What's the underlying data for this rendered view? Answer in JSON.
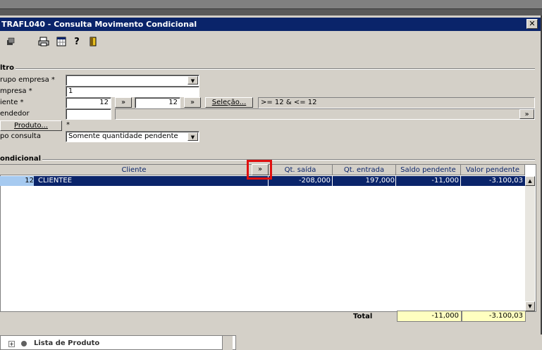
{
  "window": {
    "title": "TRAFL040 - Consulta Movimento Condicional",
    "close_label": "✕"
  },
  "toolbar": {
    "icons": [
      "window-icon",
      "printer-icon",
      "calculator-icon",
      "help-icon",
      "exit-icon"
    ],
    "help_glyph": "?"
  },
  "filter": {
    "legend": "ltro",
    "grupo_empresa_label": "rupo empresa *",
    "grupo_empresa_value": "",
    "empresa_label": "mpresa *",
    "empresa_value": "1",
    "cliente_label": "iente *",
    "cliente_from": "12",
    "cliente_to": "12",
    "more_label": "»",
    "selecao_label": "Seleção...",
    "selecao_expr": ">= 12 & <= 12",
    "vendedor_label": "endedor",
    "vendedor_value": "",
    "produto_label": "Produto...",
    "produto_value": "*",
    "tipo_label": "po consulta",
    "tipo_value": "Somente quantidade pendente"
  },
  "grid": {
    "legend": "ondicional",
    "columns": [
      "Cliente",
      "Qt. saída",
      "Qt. entrada",
      "Saldo pendente",
      "Valor pendente"
    ],
    "expand_label": "»",
    "rows": [
      {
        "code": "12",
        "cliente": "CLIENTEE",
        "qt_saida": "-208,000",
        "qt_entrada": "197,000",
        "saldo": "-11,000",
        "valor": "-3.100,03"
      }
    ],
    "total_label": "Total",
    "total_saldo": "-11,000",
    "total_valor": "-3.100,03"
  },
  "bottom": {
    "tree_item": "Lista de Produto"
  }
}
